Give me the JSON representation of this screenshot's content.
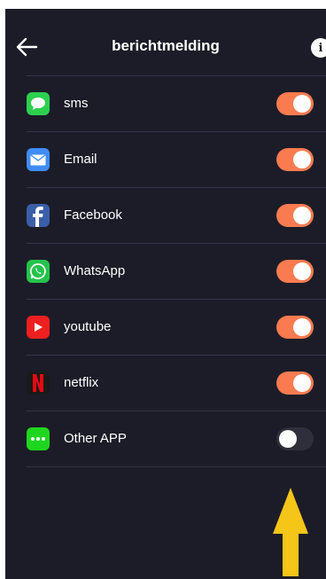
{
  "header": {
    "title": "berichtmelding",
    "info_glyph": "i"
  },
  "colors": {
    "background": "#1c1c28",
    "divider": "#34344a",
    "toggle_on": "#f97b4f",
    "toggle_off": "#2f2f3b",
    "annotation_arrow": "#f5c518"
  },
  "apps": [
    {
      "label": "sms",
      "icon": "message-bubble-icon",
      "color": "#2dd04e",
      "enabled": true
    },
    {
      "label": "Email",
      "icon": "envelope-icon",
      "color": "#3f8cf5",
      "enabled": true
    },
    {
      "label": "Facebook",
      "icon": "facebook-icon",
      "color": "#3b5ea9",
      "enabled": true
    },
    {
      "label": "WhatsApp",
      "icon": "whatsapp-icon",
      "color": "#25c34b",
      "enabled": true
    },
    {
      "label": "youtube",
      "icon": "youtube-icon",
      "color": "#ee1f1f",
      "enabled": true
    },
    {
      "label": "netflix",
      "icon": "netflix-icon",
      "color": "#1a1a1a",
      "enabled": true
    },
    {
      "label": "Other APP",
      "icon": "more-dots-icon",
      "color": "#1fd61f",
      "enabled": false
    }
  ]
}
